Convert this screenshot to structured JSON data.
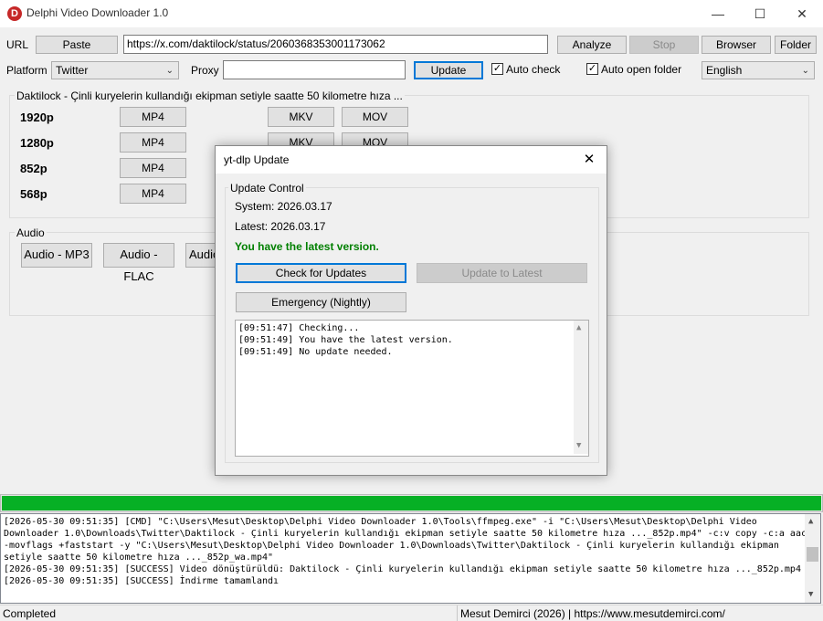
{
  "window": {
    "title": "Delphi Video Downloader 1.0",
    "icon_letter": "D"
  },
  "toolbar": {
    "url_label": "URL",
    "paste_label": "Paste",
    "url_value": "https://x.com/daktilock/status/2060368353001173062",
    "analyze_label": "Analyze",
    "stop_label": "Stop",
    "browser_label": "Browser",
    "folder_label": "Folder",
    "platform_label": "Platform",
    "platform_value": "Twitter",
    "proxy_label": "Proxy",
    "proxy_value": "",
    "update_label": "Update",
    "auto_check_label": "Auto check",
    "auto_check_checked": true,
    "auto_open_label": "Auto open folder",
    "auto_open_checked": true,
    "language_value": "English"
  },
  "video_group": {
    "title": "Daktilock - Çinli kuryelerin kullandığı ekipman setiyle saatte 50 kilometre hıza ...",
    "rows": [
      {
        "res": "1920p",
        "formats": [
          "MP4",
          "MKV",
          "MOV"
        ]
      },
      {
        "res": "1280p",
        "formats": [
          "MP4",
          "MKV",
          "MOV"
        ]
      },
      {
        "res": "852p",
        "formats": [
          "MP4"
        ]
      },
      {
        "res": "568p",
        "formats": [
          "MP4"
        ]
      }
    ]
  },
  "audio_group": {
    "title": "Audio",
    "buttons": [
      "Audio - MP3",
      "Audio - FLAC",
      "Audio"
    ]
  },
  "dialog": {
    "title": "yt-dlp Update",
    "group_title": "Update Control",
    "system_text": "System: 2026.03.17",
    "latest_text": "Latest: 2026.03.17",
    "status_text": "You have the latest version.",
    "status_color": "#008000",
    "check_label": "Check for Updates",
    "update_latest_label": "Update to Latest",
    "emergency_label": "Emergency (Nightly)",
    "log": [
      "[09:51:47] Checking...",
      "[09:51:49] You have the latest version.",
      "[09:51:49] No update needed."
    ]
  },
  "progress": {
    "percent": 100,
    "color": "#06b025"
  },
  "main_log": [
    "[2026-05-30 09:51:35] [CMD] \"C:\\Users\\Mesut\\Desktop\\Delphi Video Downloader 1.0\\Tools\\ffmpeg.exe\" -i \"C:\\Users\\Mesut\\Desktop\\Delphi Video",
    "Downloader 1.0\\Downloads\\Twitter\\Daktilock - Çinli kuryelerin kullandığı ekipman setiyle saatte 50 kilometre hıza ..._852p.mp4\" -c:v copy -c:a aac",
    "-movflags +faststart -y \"C:\\Users\\Mesut\\Desktop\\Delphi Video Downloader 1.0\\Downloads\\Twitter\\Daktilock - Çinli kuryelerin kullandığı ekipman",
    "setiyle saatte 50 kilometre hıza ..._852p_wa.mp4\"",
    "[2026-05-30 09:51:35] [SUCCESS] Video dönüştürüldü: Daktilock - Çinli kuryelerin kullandığı ekipman setiyle saatte 50 kilometre hıza ..._852p.mp4",
    "[2026-05-30 09:51:35] [SUCCESS] İndirme tamamlandı"
  ],
  "statusbar": {
    "left": "Completed",
    "right": "Mesut Demirci (2026) | https://www.mesutdemirci.com/"
  }
}
